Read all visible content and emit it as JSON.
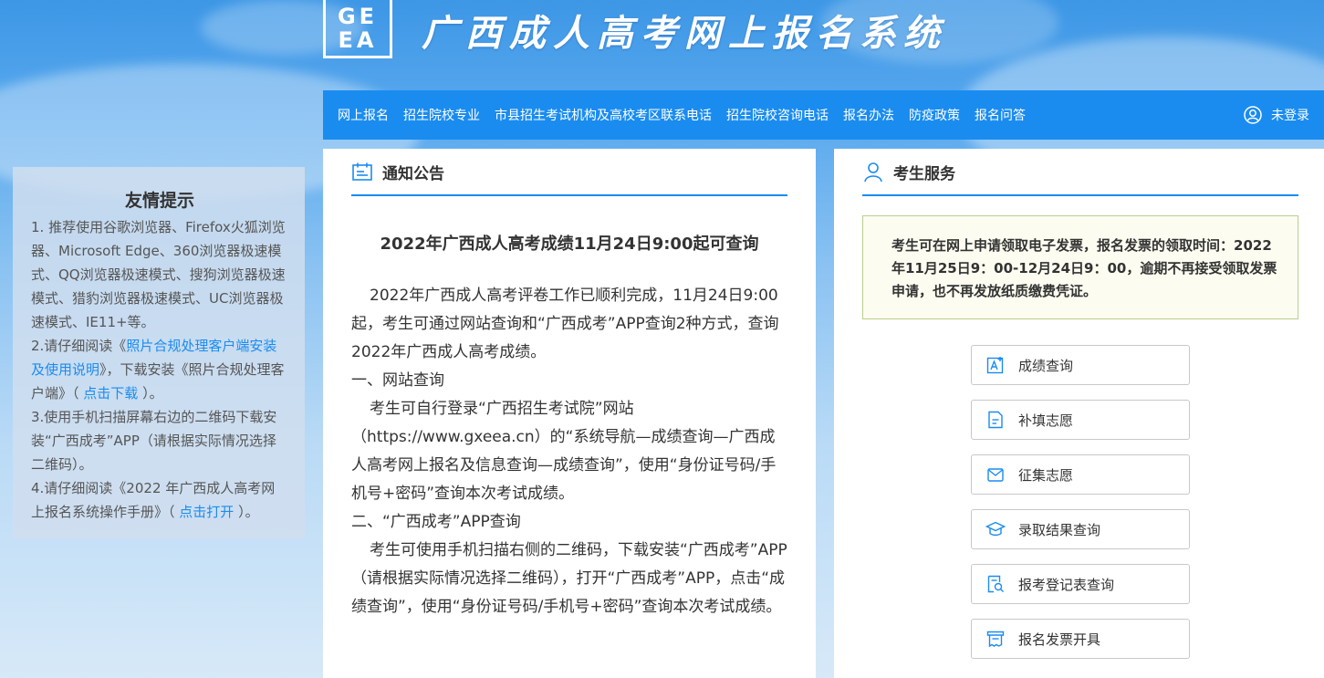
{
  "header": {
    "logo_line1": "GE",
    "logo_line2": "EA",
    "site_title": "广西成人高考网上报名系统"
  },
  "nav": {
    "items": [
      {
        "label": "网上报名"
      },
      {
        "label": "招生院校专业"
      },
      {
        "label": "市县招生考试机构及高校考区联系电话"
      },
      {
        "label": "招生院校咨询电话"
      },
      {
        "label": "报名办法"
      },
      {
        "label": "防疫政策"
      },
      {
        "label": "报名问答"
      }
    ],
    "user_label": "未登录"
  },
  "tips": {
    "title": "友情提示",
    "item1": "1. 推荐使用谷歌浏览器、Firefox火狐浏览器、Microsoft Edge、360浏览器极速模式、QQ浏览器极速模式、搜狗浏览器极速模式、猎豹浏览器极速模式、UC浏览器极速模式、IE11+等。",
    "item2_pre": "2.请仔细阅读《",
    "item2_link1": "照片合规处理客户端安装及使用说明",
    "item2_mid": "》，下载安装《照片合规处理客户端》（ ",
    "item2_link2": "点击下载",
    "item2_post": " ）。",
    "item3": "3.使用手机扫描屏幕右边的二维码下载安装“广西成考”APP（请根据实际情况选择二维码）。",
    "item4_pre": "4.请仔细阅读《2022 年广西成人高考网上报名系统操作手册》（ ",
    "item4_link": "点击打开",
    "item4_post": " ）。"
  },
  "notice": {
    "panel_title": "通知公告",
    "title": "2022年广西成人高考成绩11月24日9:00起可查询",
    "p1": "2022年广西成人高考评卷工作已顺利完成，11月24日9:00起，考生可通过网站查询和“广西成考”APP查询2种方式，查询2022年广西成人高考成绩。",
    "h1": "一、网站查询",
    "p2": "考生可自行登录“广西招生考试院”网站（https://www.gxeea.cn）的“系统导航—成绩查询—广西成人高考网上报名及信息查询—成绩查询”，使用“身份证号码/手机号+密码”查询本次考试成绩。",
    "h2": "二、“广西成考”APP查询",
    "p3": "考生可使用手机扫描右侧的二维码，下载安装“广西成考”APP（请根据实际情况选择二维码），打开“广西成考”APP，点击“成绩查询”，使用“身份证号码/手机号+密码”查询本次考试成绩。"
  },
  "service": {
    "panel_title": "考生服务",
    "invoice_text": "考生可在网上申请领取电子发票，报名发票的领取时间：2022年11月25日9：00-12月24日9：00，逾期不再接受领取发票申请，也不再发放纸质缴费凭证。",
    "buttons": [
      {
        "label": "成绩查询",
        "icon": "score-query-icon"
      },
      {
        "label": "补填志愿",
        "icon": "document-icon"
      },
      {
        "label": "征集志愿",
        "icon": "mail-icon"
      },
      {
        "label": "录取结果查询",
        "icon": "graduation-cap-icon"
      },
      {
        "label": "报考登记表查询",
        "icon": "form-search-icon"
      },
      {
        "label": "报名发票开具",
        "icon": "invoice-icon"
      }
    ]
  },
  "colors": {
    "primary": "#1a8cf0",
    "link": "#1a8cf0",
    "invoice_bg": "#fdfcf1",
    "invoice_border": "#b8d08a"
  }
}
